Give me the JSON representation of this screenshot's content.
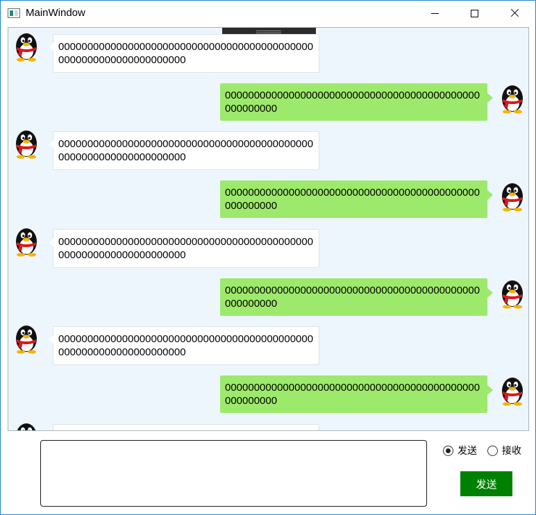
{
  "window": {
    "title": "MainWindow"
  },
  "messages": [
    {
      "side": "left",
      "text": "000000000000000000000000000000000000000000000000000000000000000000"
    },
    {
      "side": "right",
      "text": "00000000000000000000000000000000000000000000000000000"
    },
    {
      "side": "left",
      "text": "000000000000000000000000000000000000000000000000000000000000000000"
    },
    {
      "side": "right",
      "text": "00000000000000000000000000000000000000000000000000000"
    },
    {
      "side": "left",
      "text": "000000000000000000000000000000000000000000000000000000000000000000"
    },
    {
      "side": "right",
      "text": "00000000000000000000000000000000000000000000000000000"
    },
    {
      "side": "left",
      "text": "000000000000000000000000000000000000000000000000000000000000000000"
    },
    {
      "side": "right",
      "text": "00000000000000000000000000000000000000000000000000000"
    },
    {
      "side": "left",
      "text": ""
    }
  ],
  "composer": {
    "input_value": "",
    "mode_options": [
      {
        "label": "发送",
        "checked": true
      },
      {
        "label": "接收",
        "checked": false
      }
    ],
    "send_label": "发送"
  },
  "colors": {
    "outgoing_bubble": "#9de96c",
    "incoming_bubble": "#ffffff",
    "chat_background": "#edf6fd",
    "send_button": "#008000",
    "window_border": "#1883d7"
  },
  "icons": {
    "avatar": "penguin-avatar-icon",
    "app": "window-app-icon"
  }
}
